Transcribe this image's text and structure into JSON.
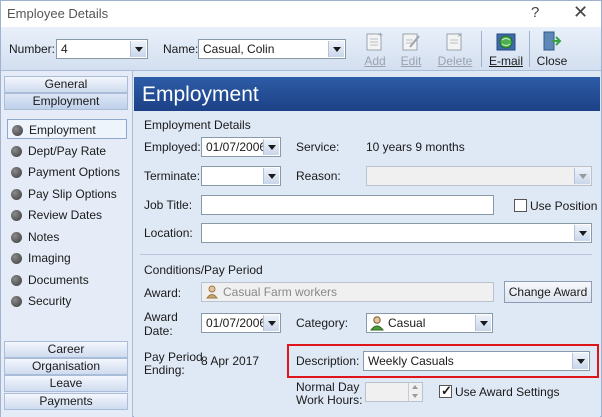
{
  "window": {
    "title": "Employee Details",
    "help": "?",
    "close": "✕"
  },
  "toolbar": {
    "number_label": "Number:",
    "number_value": "4",
    "name_label": "Name:",
    "name_value": "Casual, Colin",
    "buttons": [
      {
        "label": "Add",
        "enabled": false,
        "icon": "add-document-icon"
      },
      {
        "label": "Edit",
        "enabled": false,
        "icon": "edit-document-icon"
      },
      {
        "label": "Delete",
        "enabled": false,
        "icon": "delete-document-icon"
      },
      {
        "label": "E-mail",
        "enabled": true,
        "icon": "email-globe-icon"
      },
      {
        "label": "Close",
        "enabled": true,
        "icon": "door-exit-icon"
      }
    ]
  },
  "nav": {
    "top_headers": [
      "General",
      "Employment"
    ],
    "items": [
      "Employment",
      "Dept/Pay Rate",
      "Payment Options",
      "Pay Slip Options",
      "Review Dates",
      "Notes",
      "Imaging",
      "Documents",
      "Security"
    ],
    "bottom_headers": [
      "Career",
      "Organisation",
      "Leave",
      "Payments"
    ]
  },
  "main": {
    "banner": "Employment",
    "details_heading": "Employment Details",
    "employed_label": "Employed:",
    "employed_value": "01/07/2006",
    "service_label": "Service:",
    "service_value": "10 years 9 months",
    "terminate_label": "Terminate:",
    "terminate_value": "",
    "reason_label": "Reason:",
    "reason_value": "",
    "job_title_label": "Job Title:",
    "job_title_value": "",
    "use_position_label": "Use Position",
    "location_label": "Location:",
    "location_value": "",
    "conditions_heading": "Conditions/Pay Period",
    "award_label": "Award:",
    "award_value": "Casual Farm workers",
    "change_award_label": "Change Award",
    "award_date_label_1": "Award",
    "award_date_label_2": "Date:",
    "award_date_value": "01/07/2006",
    "category_label": "Category:",
    "category_value": "Casual",
    "pay_period_label_1": "Pay Period",
    "pay_period_label_2": "Ending:",
    "pay_period_value": "8 Apr 2017",
    "description_label": "Description:",
    "description_value": "Weekly Casuals",
    "normal_day_label_1": "Normal Day",
    "normal_day_label_2": "Work Hours:",
    "normal_day_value": "",
    "use_award_settings_label": "Use Award Settings",
    "use_award_settings_checked": true,
    "use_position_checked": false
  },
  "colors": {
    "banner": "#1f4a92",
    "highlight": "#e0151b",
    "background": "#dfe8f5"
  }
}
